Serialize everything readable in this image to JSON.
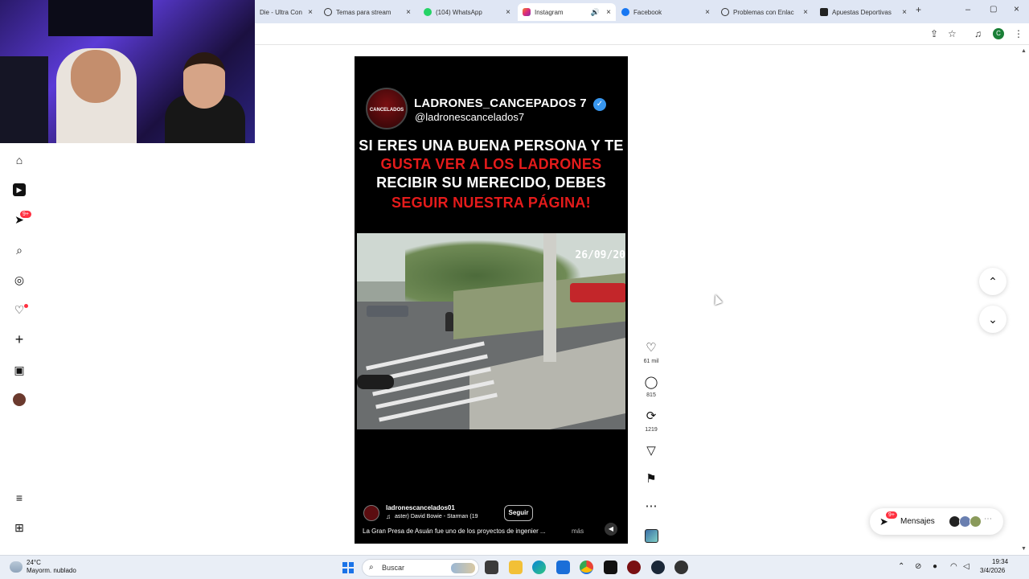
{
  "browser": {
    "tabs": [
      {
        "label": "Die - Ultra Con",
        "icon": "generic-icon",
        "color": "#7a7a7a"
      },
      {
        "label": "Temas para stream",
        "icon": "chatgpt-icon",
        "color": "#333333"
      },
      {
        "label": "(104) WhatsApp",
        "icon": "whatsapp-icon",
        "color": "#25d366"
      },
      {
        "label": "Instagram",
        "icon": "instagram-icon",
        "color": "#e1306c"
      },
      {
        "label": "Facebook",
        "icon": "facebook-icon",
        "color": "#1877f2"
      },
      {
        "label": "Problemas con Enlac",
        "icon": "chatgpt-icon",
        "color": "#333333"
      },
      {
        "label": "Apuestas Deportivas",
        "icon": "betting-icon",
        "color": "#222222"
      }
    ],
    "profile_initial": "C"
  },
  "sidebar": {
    "notification_badge": "9+"
  },
  "reel": {
    "channel_name": "LADRONES_CANCEPADOS 7",
    "channel_handle": "@ladronescancelados7",
    "logo_text": "CANCELADOS",
    "caption_lines": [
      {
        "text": "SI ERES UNA BUENA PERSONA Y TE",
        "color": "white"
      },
      {
        "text": "GUSTA VER A LOS LADRONES",
        "color": "red"
      },
      {
        "text": "RECIBIR SU MERECIDO, DEBES",
        "color": "white"
      },
      {
        "text": "SEGUIR NUESTRA PÁGINA!",
        "color": "red"
      }
    ],
    "video_timestamp": "26/09/20",
    "author": "ladronescancelados01",
    "music": "aster)  David Bowie - Starman (19",
    "follow_label": "Seguir",
    "description": "La Gran Presa de Asuán fue uno de los proyectos de ingenier ...",
    "more_label": "más"
  },
  "actions": {
    "likes": "61 mil",
    "comments": "815",
    "reposts": "1219"
  },
  "messages": {
    "label": "Mensajes",
    "badge": "9+"
  },
  "taskbar": {
    "weather_temp": "24°C",
    "weather_desc": "Mayorm. nublado",
    "search_placeholder": "Buscar",
    "time": "19:34",
    "date": "3/4/2026"
  },
  "colors": {
    "accent_red": "#e51b1b",
    "badge_red": "#ff3040",
    "verified_blue": "#3897f0"
  }
}
